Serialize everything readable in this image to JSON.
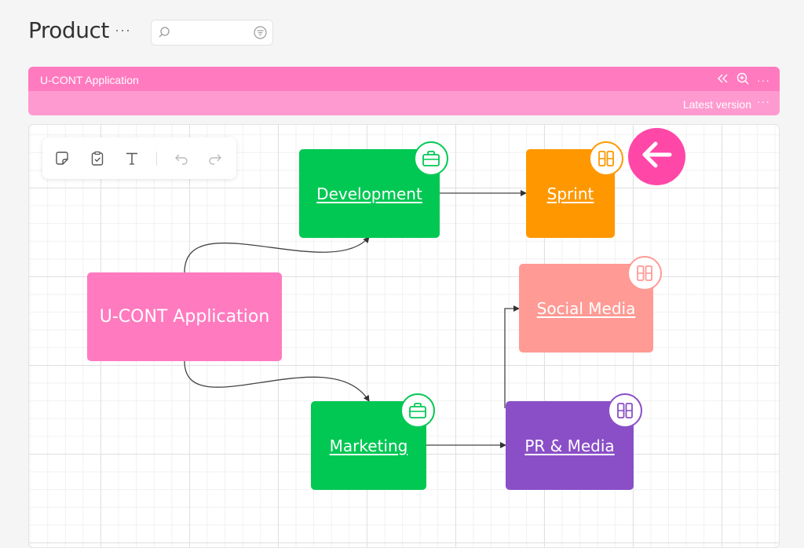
{
  "page": {
    "title": "Product",
    "more_label": "···"
  },
  "search": {
    "value": "",
    "placeholder": ""
  },
  "app_header": {
    "title": "U-CONT Application",
    "version_label": "Latest version",
    "more_label": "···"
  },
  "toolbar": {
    "icons": [
      "sticky-note-icon",
      "clipboard-check-icon",
      "text-icon",
      "undo-icon",
      "redo-icon"
    ]
  },
  "nodes": {
    "root": {
      "label": "U-CONT Application",
      "color": "#ff7abf"
    },
    "development": {
      "label": "Development",
      "color": "#00c853",
      "icon": "briefcase-icon"
    },
    "sprint": {
      "label": "Sprint",
      "color": "#ff9800",
      "icon": "columns-icon"
    },
    "social_media": {
      "label": "Social Media",
      "color": "#ff9a94",
      "icon": "columns-icon"
    },
    "marketing": {
      "label": "Marketing",
      "color": "#00c853",
      "icon": "briefcase-icon"
    },
    "pr_media": {
      "label": "PR & Media",
      "color": "#8a4fc7",
      "icon": "columns-icon"
    }
  },
  "back_button": {
    "icon": "arrow-left-icon",
    "color": "#ff47a8"
  }
}
